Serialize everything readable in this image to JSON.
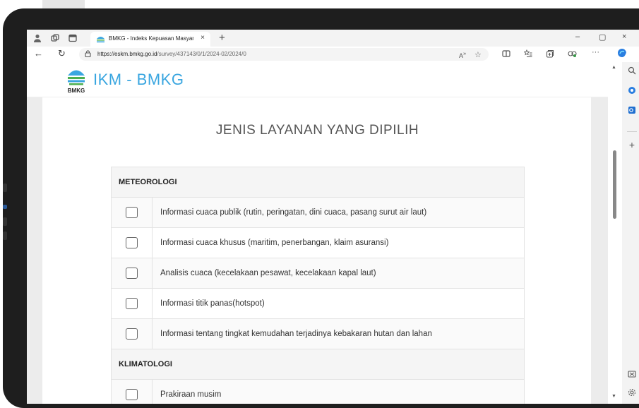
{
  "browser": {
    "tab_title": "BMKG - Indeks Kepuasan Masyar",
    "tab_close": "×",
    "new_tab": "+",
    "window": {
      "minimize": "–",
      "maximize": "▢",
      "close": "×"
    },
    "url_host": "https://eskm.bmkg.go.id",
    "url_path": "/survey/437143/0/1/2024-02/2024/0",
    "nav": {
      "back": "←",
      "reload": "↻"
    }
  },
  "site": {
    "logo_text": "IKM - BMKG",
    "logo_caption": "BMKG"
  },
  "page": {
    "title": "JENIS LAYANAN YANG DIPILIH",
    "categories": [
      {
        "name": "METEOROLOGI",
        "options": [
          "Informasi cuaca publik (rutin, peringatan, dini cuaca, pasang surut air laut)",
          "Informasi cuaca khusus (maritim, penerbangan, klaim asuransi)",
          "Analisis cuaca (kecelakaan pesawat, kecelakaan kapal laut)",
          "Informasi titik panas(hotspot)",
          "Informasi tentang tingkat kemudahan terjadinya kebakaran hutan dan lahan"
        ]
      },
      {
        "name": "KLIMATOLOGI",
        "options": [
          "Prakiraan musim"
        ]
      }
    ]
  },
  "colors": {
    "brand": "#3aa6e0",
    "page_bg": "#ececec"
  }
}
